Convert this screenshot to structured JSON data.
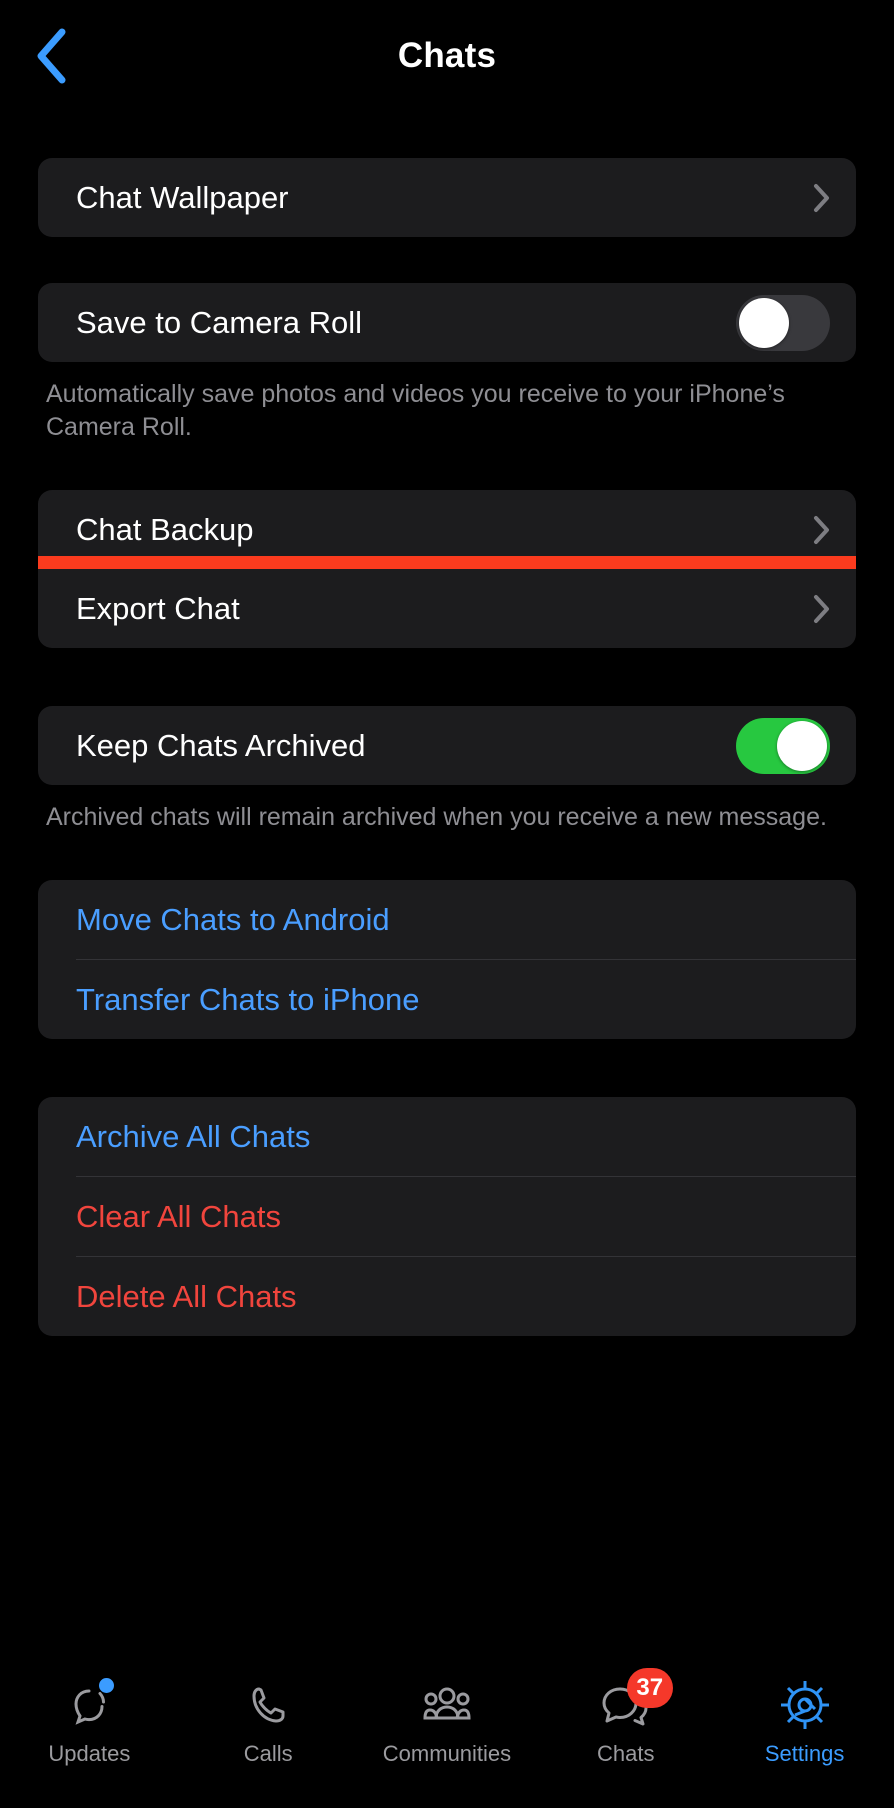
{
  "navbar": {
    "back_icon": "chevron-left-icon",
    "title": "Chats",
    "back_color": "#3b9cff"
  },
  "sections": [
    {
      "id": "wallpaper",
      "rows": [
        {
          "label": "Chat Wallpaper",
          "type": "disclosure",
          "name": "chat-wallpaper"
        }
      ]
    },
    {
      "id": "camera-roll",
      "rows": [
        {
          "label": "Save to Camera Roll",
          "type": "toggle",
          "value": "off",
          "name": "save-to-camera-roll"
        }
      ],
      "footnote": "Automatically save photos and videos you receive to your iPhone’s Camera Roll."
    },
    {
      "id": "backup-export",
      "rows": [
        {
          "label": "Chat Backup",
          "type": "disclosure",
          "name": "chat-backup"
        },
        {
          "label": "Export Chat",
          "type": "disclosure",
          "name": "export-chat",
          "highlighted": true
        }
      ]
    },
    {
      "id": "archive",
      "rows": [
        {
          "label": "Keep Chats Archived",
          "type": "toggle",
          "value": "on",
          "name": "keep-chats-archived"
        }
      ],
      "footnote": "Archived chats will remain archived when you receive a new message."
    },
    {
      "id": "transfer",
      "rows": [
        {
          "label": "Move Chats to Android",
          "type": "link",
          "name": "move-chats-to-android"
        },
        {
          "label": "Transfer Chats to iPhone",
          "type": "link",
          "name": "transfer-chats-to-iphone"
        }
      ]
    },
    {
      "id": "bulk-actions",
      "rows": [
        {
          "label": "Archive All Chats",
          "type": "link",
          "name": "archive-all-chats"
        },
        {
          "label": "Clear All Chats",
          "type": "destructive",
          "name": "clear-all-chats"
        },
        {
          "label": "Delete All Chats",
          "type": "destructive",
          "name": "delete-all-chats"
        }
      ]
    }
  ],
  "labels": {
    "chat_wallpaper": "Chat Wallpaper",
    "save_to_camera_roll": "Save to Camera Roll",
    "camera_roll_footnote": "Automatically save photos and videos you receive to your iPhone’s Camera Roll.",
    "chat_backup": "Chat Backup",
    "export_chat": "Export Chat",
    "keep_chats_archived": "Keep Chats Archived",
    "archived_footnote": "Archived chats will remain archived when you receive a new message.",
    "move_chats_to_android": "Move Chats to Android",
    "transfer_chats_to_iphone": "Transfer Chats to iPhone",
    "archive_all_chats": "Archive All Chats",
    "clear_all_chats": "Clear All Chats",
    "delete_all_chats": "Delete All Chats"
  },
  "tabbar": {
    "items": [
      {
        "label": "Updates",
        "icon": "updates-icon",
        "active": false,
        "dot": true
      },
      {
        "label": "Calls",
        "icon": "phone-icon",
        "active": false
      },
      {
        "label": "Communities",
        "icon": "communities-icon",
        "active": false
      },
      {
        "label": "Chats",
        "icon": "chat-bubbles-icon",
        "active": false,
        "badge": "37"
      },
      {
        "label": "Settings",
        "icon": "gear-icon",
        "active": true
      }
    ]
  },
  "colors": {
    "background": "#000000",
    "group": "#1c1c1e",
    "accent_blue": "#4a9eff",
    "destructive_red": "#f1453d",
    "toggle_on_green": "#27c840",
    "toggle_off_gray": "#39393d",
    "highlight_orange_red": "#fb3b1e",
    "badge_red": "#f5382a",
    "footnote_gray": "#8e8e93"
  },
  "highlight": {
    "target": "Export Chat",
    "color": "#fb3b1e"
  }
}
